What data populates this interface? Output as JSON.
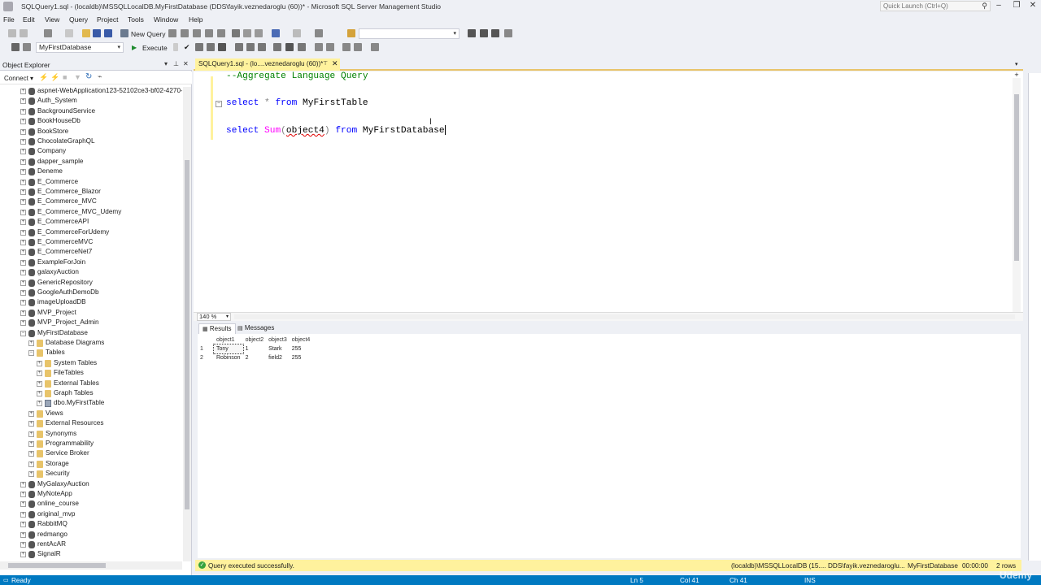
{
  "window": {
    "title": "SQLQuery1.sql - (localdb)\\MSSQLLocalDB.MyFirstDatabase (DDS\\fayik.veznedaroglu (60))* - Microsoft SQL Server Management Studio",
    "quick_launch_placeholder": "Quick Launch (Ctrl+Q)"
  },
  "menu": [
    "File",
    "Edit",
    "View",
    "Query",
    "Project",
    "Tools",
    "Window",
    "Help"
  ],
  "toolbar": {
    "new_query": "New Query",
    "database": "MyFirstDatabase",
    "execute": "Execute"
  },
  "object_explorer": {
    "title": "Object Explorer",
    "connect": "Connect",
    "nodes": [
      "aspnet-WebApplication123-52102ce3-bf02-4270-",
      "Auth_System",
      "BackgroundService",
      "BookHouseDb",
      "BookStore",
      "ChocolateGraphQL",
      "Company",
      "dapper_sample",
      "Deneme",
      "E_Commerce",
      "E_Commerce_Blazor",
      "E_Commerce_MVC",
      "E_Commerce_MVC_Udemy",
      "E_CommerceAPI",
      "E_CommerceForUdemy",
      "E_CommerceMVC",
      "E_CommerceNet7",
      "ExampleForJoin",
      "galaxyAuction",
      "GenericRepository",
      "GoogleAuthDemoDb",
      "imageUploadDB",
      "MVP_Project",
      "MVP_Project_Admin",
      "MyFirstDatabase",
      "Database Diagrams",
      "Tables",
      "System Tables",
      "FileTables",
      "External Tables",
      "Graph Tables",
      "dbo.MyFirstTable",
      "Views",
      "External Resources",
      "Synonyms",
      "Programmability",
      "Service Broker",
      "Storage",
      "Security",
      "MyGalaxyAuction",
      "MyNoteApp",
      "online_course",
      "original_mvp",
      "RabbitMQ",
      "redmango",
      "rentAcAR",
      "SignalR"
    ]
  },
  "editor": {
    "tab_label": "SQLQuery1.sql - (lo....veznedaroglu (60))*",
    "line1_comment": "--Aggregate Language Query",
    "line2": {
      "kw1": "select",
      "star": "*",
      "kw2": "from",
      "ident": "MyFirstTable"
    },
    "line3": {
      "kw1": "select",
      "fn": "Sum",
      "open": "(",
      "arg": "object4",
      "close": ")",
      "kw2": "from",
      "ident": "MyFirstDatabase"
    },
    "zoom": "140 %"
  },
  "results": {
    "tabs": [
      "Results",
      "Messages"
    ],
    "columns": [
      "object1",
      "object2",
      "object3",
      "object4"
    ],
    "rows": [
      [
        "1",
        "Tony",
        "1",
        "Stark",
        "255"
      ],
      [
        "2",
        "Robinson",
        "2",
        "field2",
        "255"
      ]
    ]
  },
  "query_status": {
    "message": "Query executed successfully.",
    "server": "(localdb)\\MSSQLLocalDB (15....",
    "user": "DDS\\fayik.veznedaroglu...",
    "database": "MyFirstDatabase",
    "time": "00:00:00",
    "rows": "2 rows"
  },
  "app_status": {
    "ready": "Ready",
    "ln": "Ln 5",
    "col": "Col 41",
    "ch": "Ch 41",
    "mode": "INS"
  },
  "watermark": "Udemy",
  "colors": {
    "accent_blue": "#0079c1",
    "query_status_yellow": "#fff29d",
    "keyword_blue": "#0000ff",
    "comment_green": "#008000",
    "function_magenta": "#ff00ff"
  }
}
